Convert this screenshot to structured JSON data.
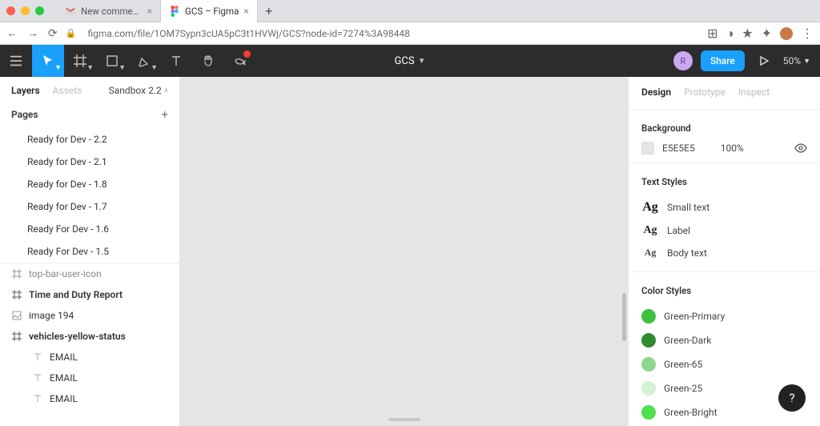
{
  "browser": {
    "tabs": [
      {
        "title": "New comments on GCS – ruth",
        "favicon": "gmail"
      },
      {
        "title": "GCS – Figma",
        "favicon": "figma",
        "active": true
      }
    ],
    "url": "figma.com/file/1OM7Sypn3cUA5pC3t1HVWj/GCS?node-id=7274%3A98448"
  },
  "toolbar": {
    "doc_name": "GCS",
    "user_initial": "R",
    "share_label": "Share",
    "zoom": "50%"
  },
  "left_panel": {
    "tabs": {
      "layers": "Layers",
      "assets": "Assets"
    },
    "page_label": "Sandbox 2.2",
    "pages_heading": "Pages",
    "pages": [
      "Ready for Dev - 2.2",
      "Ready for Dev - 2.1",
      "Ready for Dev - 1.8",
      "Ready for Dev - 1.7",
      "Ready For Dev - 1.6",
      "Ready For Dev - 1.5"
    ],
    "layers": [
      {
        "icon": "frame",
        "label": "top-bar-user-icon",
        "truncated": true
      },
      {
        "icon": "frame",
        "label": "Time and Duty Report",
        "bold": true
      },
      {
        "icon": "image",
        "label": "image 194"
      },
      {
        "icon": "frame",
        "label": "vehicles-yellow-status",
        "bold": true
      },
      {
        "icon": "text",
        "label": "EMAIL",
        "child": true
      },
      {
        "icon": "text",
        "label": "EMAIL",
        "child": true
      },
      {
        "icon": "text",
        "label": "EMAIL",
        "child": true
      }
    ]
  },
  "right_panel": {
    "tabs": {
      "design": "Design",
      "prototype": "Prototype",
      "inspect": "Inspect"
    },
    "background": {
      "label": "Background",
      "hex": "E5E5E5",
      "opacity": "100%"
    },
    "text_styles": {
      "label": "Text Styles",
      "items": [
        "Small text",
        "Label",
        "Body text"
      ]
    },
    "color_styles": {
      "label": "Color Styles",
      "items": [
        {
          "name": "Green-Primary",
          "hex": "#3FBF3F"
        },
        {
          "name": "Green-Dark",
          "hex": "#2E8B2E"
        },
        {
          "name": "Green-65",
          "hex": "#8FD68F"
        },
        {
          "name": "Green-25",
          "hex": "#D5F0D5"
        },
        {
          "name": "Green-Bright",
          "hex": "#4FE04F"
        }
      ]
    }
  },
  "help": "?"
}
